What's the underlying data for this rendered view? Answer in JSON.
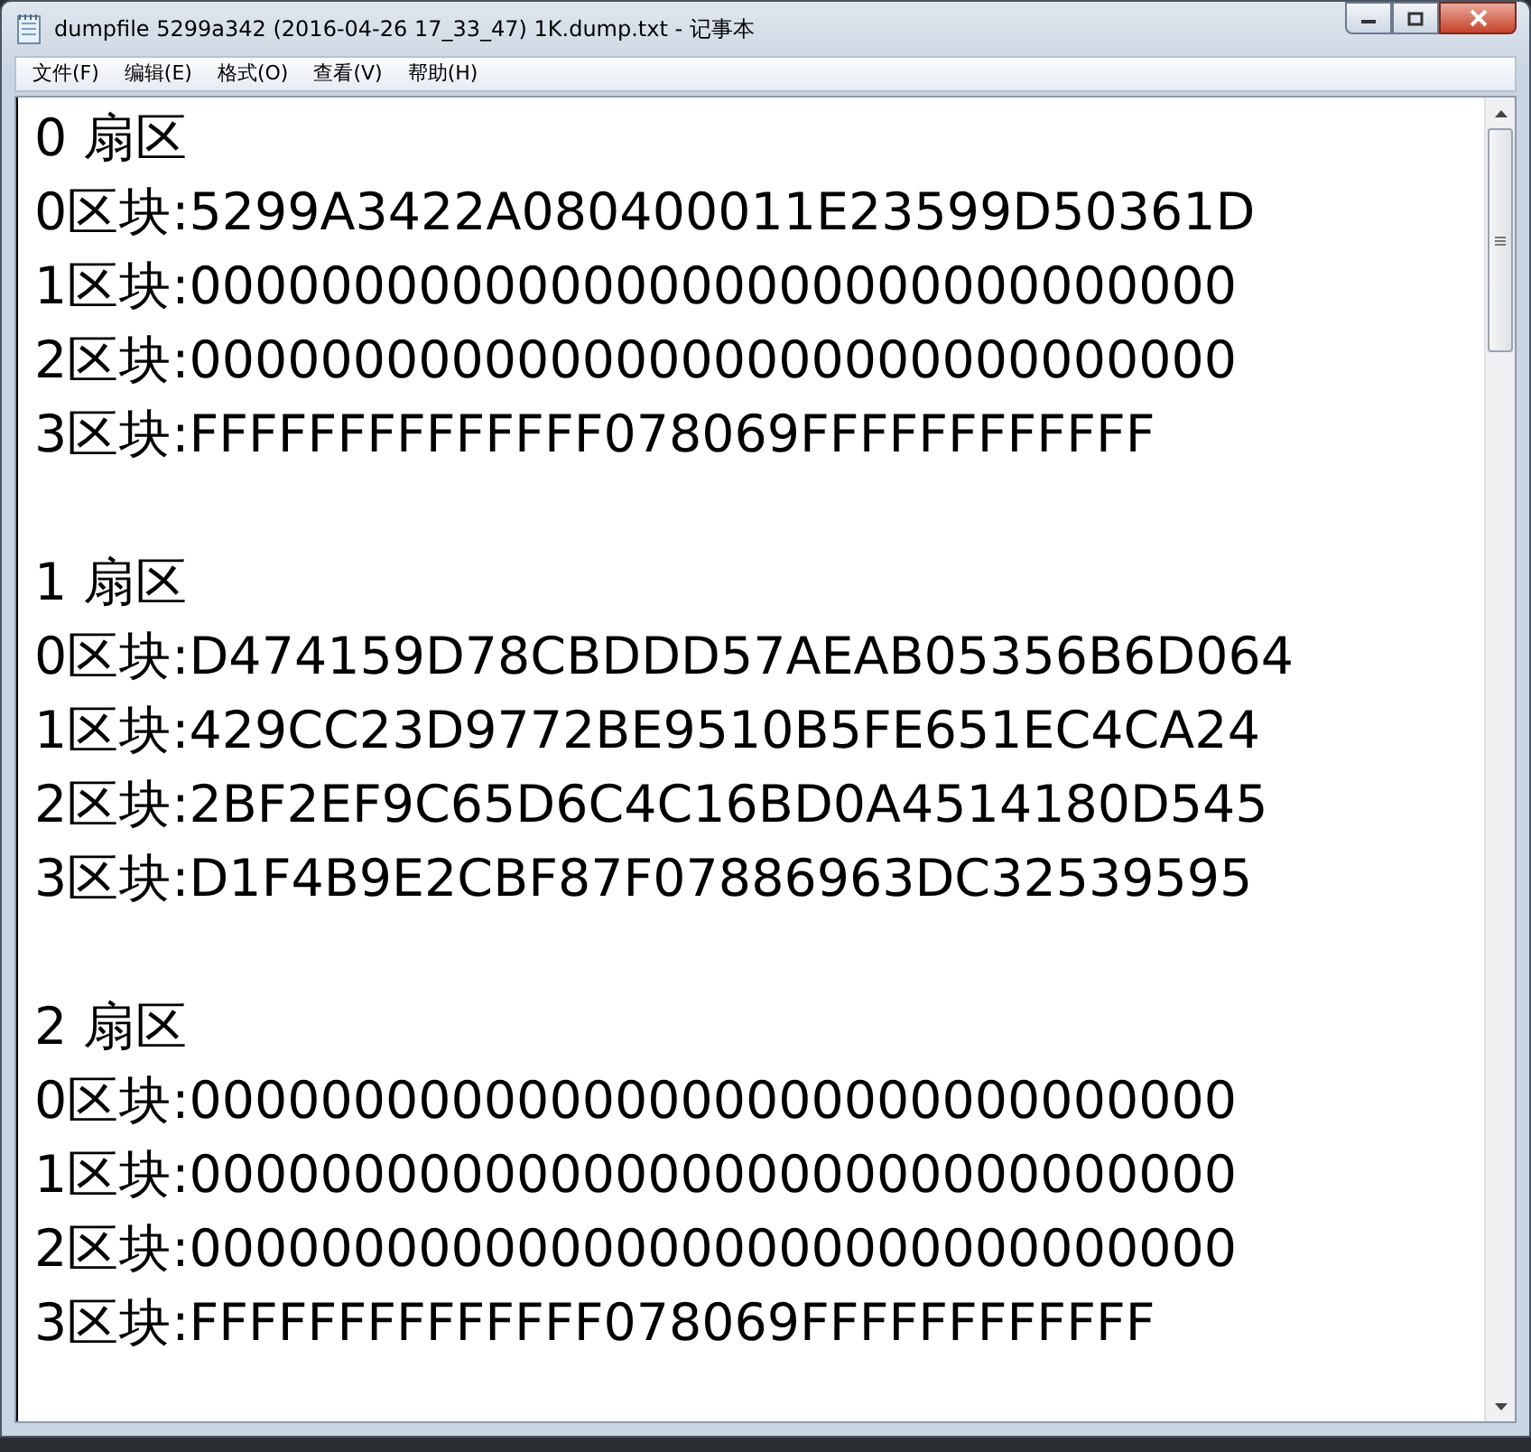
{
  "window": {
    "title": "dumpfile 5299a342 (2016-04-26 17_33_47) 1K.dump.txt - 记事本"
  },
  "menu": [
    "文件(F)",
    "编辑(E)",
    "格式(O)",
    "查看(V)",
    "帮助(H)"
  ],
  "sectors": [
    {
      "title": "0 扇区",
      "blocks": [
        "0区块:5299A3422A080400011E23599D50361D",
        "1区块:00000000000000000000000000000000",
        "2区块:00000000000000000000000000000000",
        "3区块:FFFFFFFFFFFFFF078069FFFFFFFFFFFF"
      ]
    },
    {
      "title": "1 扇区",
      "blocks": [
        "0区块:D474159D78CBDDD57AEAB05356B6D064",
        "1区块:429CC23D9772BE9510B5FE651EC4CA24",
        "2区块:2BF2EF9C65D6C4C16BD0A4514180D545",
        "3区块:D1F4B9E2CBF87F07886963DC32539595"
      ]
    },
    {
      "title": "2 扇区",
      "blocks": [
        "0区块:00000000000000000000000000000000",
        "1区块:00000000000000000000000000000000",
        "2区块:00000000000000000000000000000000",
        "3区块:FFFFFFFFFFFFFF078069FFFFFFFFFFFF"
      ]
    }
  ]
}
